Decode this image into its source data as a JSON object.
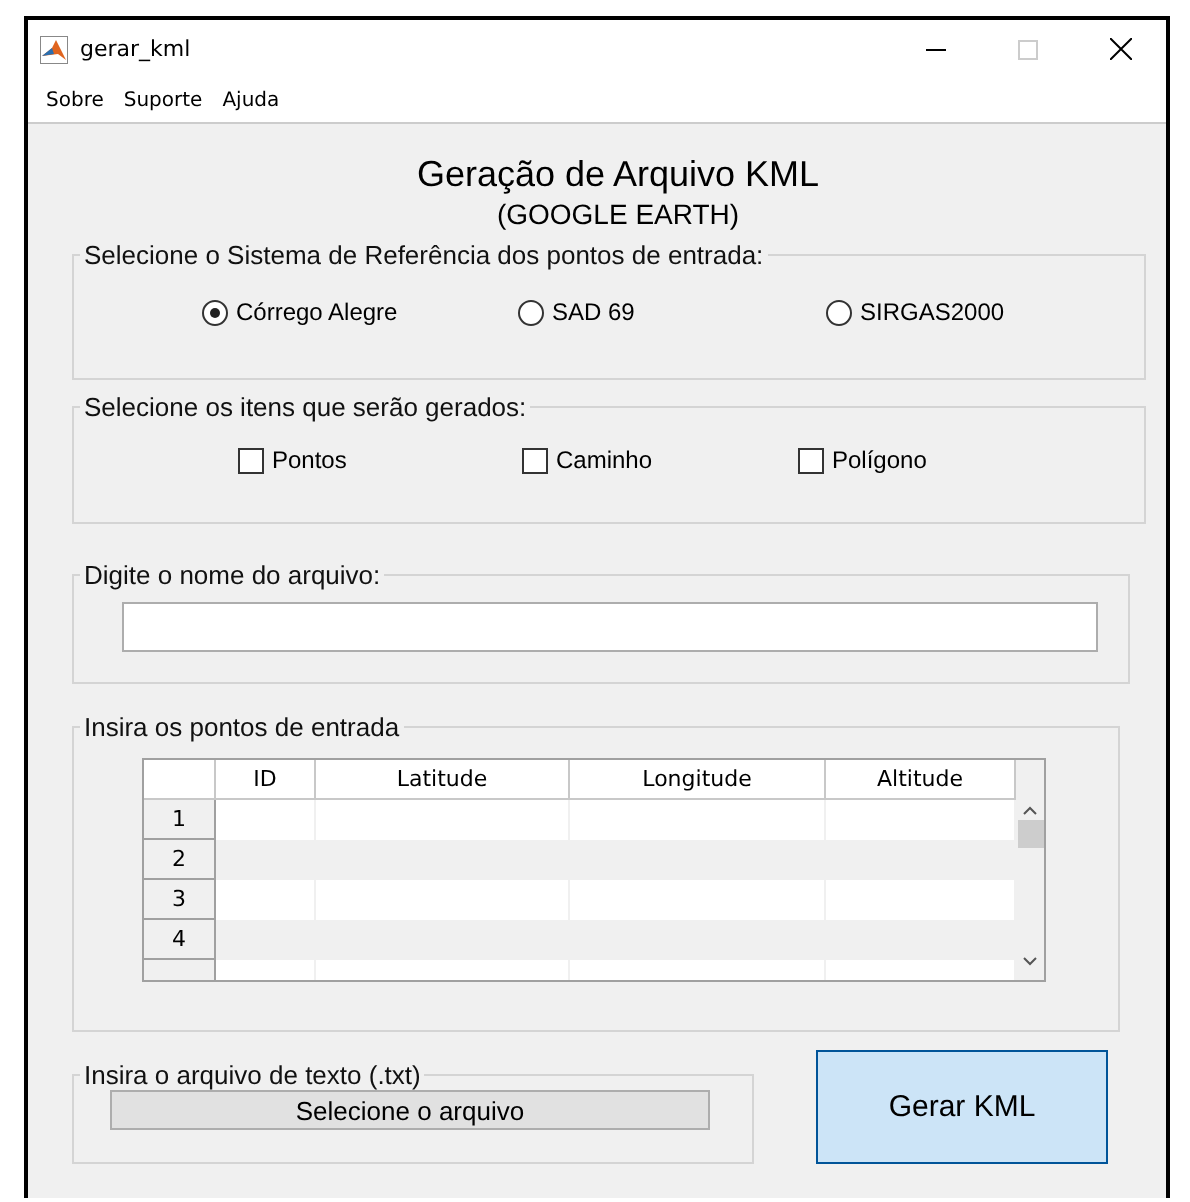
{
  "window": {
    "title": "gerar_kml"
  },
  "menu": [
    "Sobre",
    "Suporte",
    "Ajuda"
  ],
  "title": "Geração de Arquivo KML",
  "subtitle": "(GOOGLE EARTH)",
  "reference_panel": {
    "legend": "Selecione o Sistema de Referência dos pontos de entrada:",
    "options": [
      {
        "label": "Córrego Alegre",
        "selected": true
      },
      {
        "label": "SAD 69",
        "selected": false
      },
      {
        "label": "SIRGAS2000",
        "selected": false
      }
    ]
  },
  "items_panel": {
    "legend": "Selecione os itens que serão gerados:",
    "options": [
      {
        "label": "Pontos",
        "checked": false
      },
      {
        "label": "Caminho",
        "checked": false
      },
      {
        "label": "Polígono",
        "checked": false
      }
    ]
  },
  "file_name_panel": {
    "legend": "Digite o nome do arquivo:"
  },
  "points_panel": {
    "legend": "Insira os pontos de entrada",
    "table": {
      "columns": [
        "ID",
        "Latitude",
        "Longitude",
        "Altitude"
      ],
      "rows": [
        "1",
        "2",
        "3",
        "4"
      ]
    }
  },
  "text_file_panel": {
    "legend": "Insira o arquivo de texto (.txt)",
    "button": "Selecione o arquivo"
  },
  "generate_button": "Gerar KML"
}
